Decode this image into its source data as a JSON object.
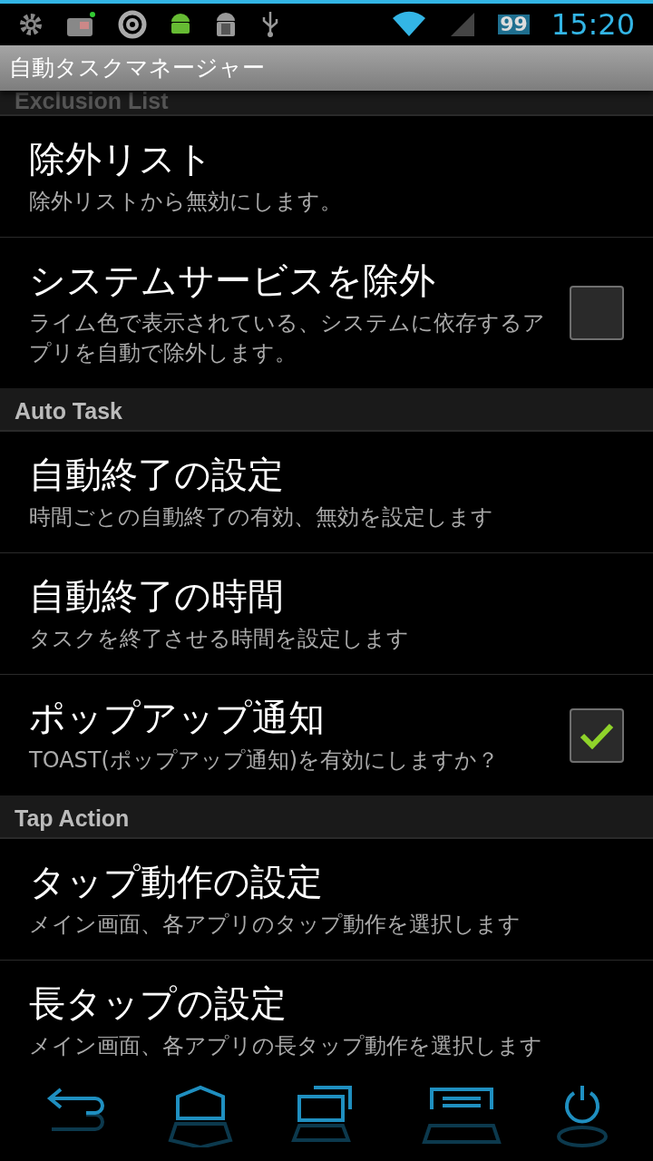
{
  "status_bar": {
    "battery": "99",
    "time": "15:20"
  },
  "action_bar": {
    "title": "自動タスクマネージャー"
  },
  "sections": [
    {
      "header": "Exclusion List",
      "items": [
        {
          "kind": "plain",
          "title": "除外リスト",
          "summary": "除外リストから無効にします。"
        },
        {
          "kind": "checkbox",
          "title": "システムサービスを除外",
          "summary": "ライム色で表示されている、システムに依存するアプリを自動で除外します。",
          "checked": false
        }
      ]
    },
    {
      "header": "Auto Task",
      "items": [
        {
          "kind": "plain",
          "title": "自動終了の設定",
          "summary": "時間ごとの自動終了の有効、無効を設定します"
        },
        {
          "kind": "plain",
          "title": "自動終了の時間",
          "summary": "タスクを終了させる時間を設定します"
        },
        {
          "kind": "checkbox",
          "title": "ポップアップ通知",
          "summary": "TOAST(ポップアップ通知)を有効にしますか？",
          "checked": true
        }
      ]
    },
    {
      "header": "Tap Action",
      "items": [
        {
          "kind": "plain",
          "title": "タップ動作の設定",
          "summary": "メイン画面、各アプリのタップ動作を選択します"
        },
        {
          "kind": "plain",
          "title": "長タップの設定",
          "summary": "メイン画面、各アプリの長タップ動作を選択します"
        }
      ]
    }
  ]
}
